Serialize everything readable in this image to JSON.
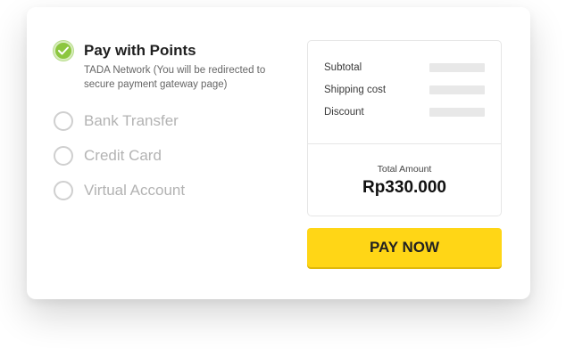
{
  "payment_methods": [
    {
      "title": "Pay with Points",
      "description": "TADA Network (You will be redirected to secure payment gateway page)",
      "selected": true
    },
    {
      "title": "Bank Transfer",
      "selected": false
    },
    {
      "title": "Credit Card",
      "selected": false
    },
    {
      "title": "Virtual Account",
      "selected": false
    }
  ],
  "summary": {
    "subtotal_label": "Subtotal",
    "shipping_label": "Shipping cost",
    "discount_label": "Discount",
    "total_label": "Total Amount",
    "total_value": "Rp330.000"
  },
  "pay_button_label": "PAY NOW",
  "colors": {
    "accent_yellow": "#ffd616",
    "selected_green": "#8cc63f"
  }
}
